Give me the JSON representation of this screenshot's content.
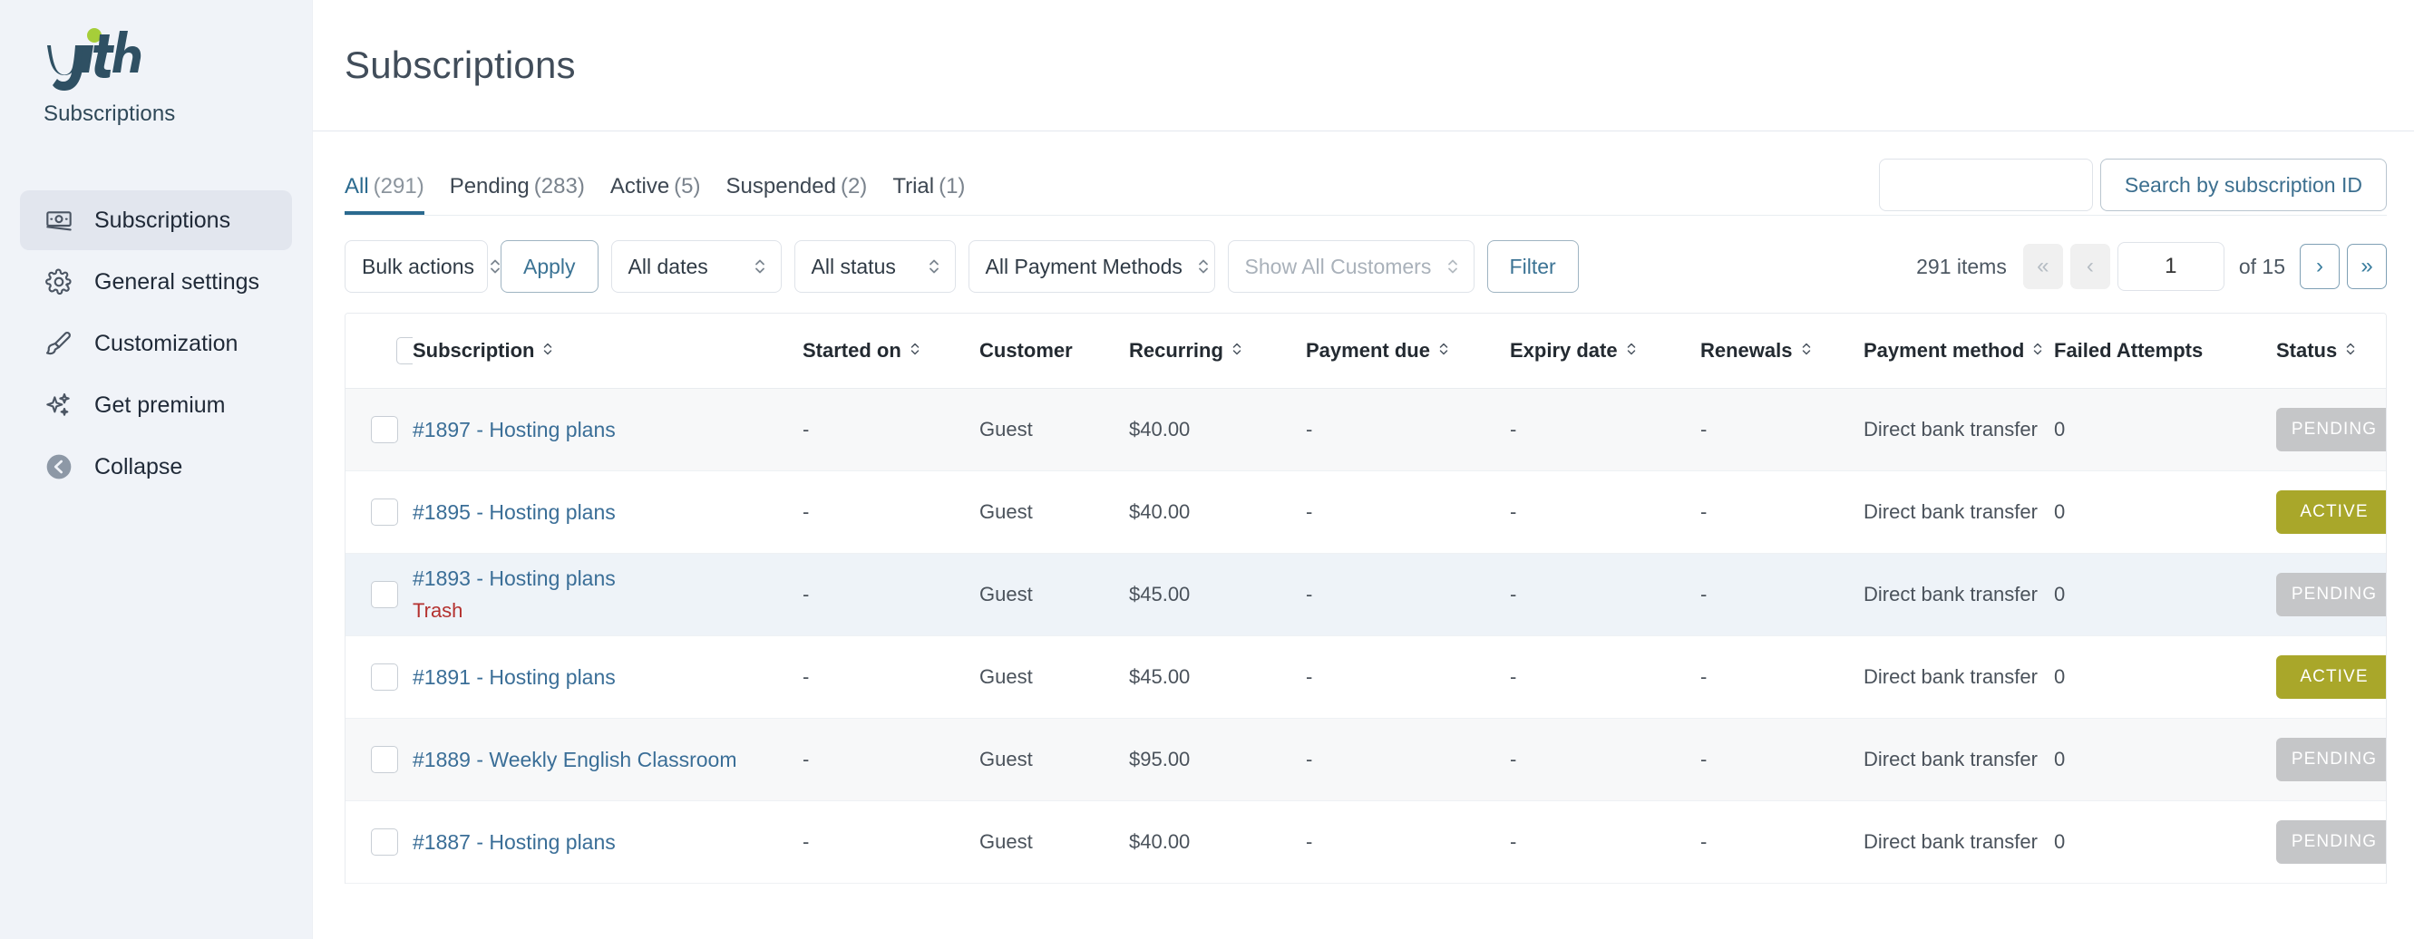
{
  "brand": {
    "name": "yith",
    "subtitle": "Subscriptions"
  },
  "sidebar": {
    "items": [
      {
        "label": "Subscriptions",
        "icon": "money-note-icon",
        "active": true
      },
      {
        "label": "General settings",
        "icon": "gear-icon",
        "active": false
      },
      {
        "label": "Customization",
        "icon": "brush-icon",
        "active": false
      },
      {
        "label": "Get premium",
        "icon": "sparkles-icon",
        "active": false
      },
      {
        "label": "Collapse",
        "icon": "arrow-left-circle-icon",
        "active": false
      }
    ]
  },
  "header": {
    "title": "Subscriptions"
  },
  "search": {
    "value": "",
    "placeholder": "",
    "button_label": "Search by subscription ID"
  },
  "tabs": [
    {
      "label": "All",
      "count": "(291)",
      "active": true
    },
    {
      "label": "Pending",
      "count": "(283)",
      "active": false
    },
    {
      "label": "Active",
      "count": "(5)",
      "active": false
    },
    {
      "label": "Suspended",
      "count": "(2)",
      "active": false
    },
    {
      "label": "Trial",
      "count": "(1)",
      "active": false
    }
  ],
  "toolbar": {
    "bulk_actions": "Bulk actions",
    "apply_label": "Apply",
    "dates": "All dates",
    "status": "All status",
    "payment_methods": "All Payment Methods",
    "customers_placeholder": "Show All Customers",
    "filter_label": "Filter"
  },
  "pagination": {
    "items_label": "291 items",
    "first": "«",
    "prev": "‹",
    "page": "1",
    "of_label": "of 15",
    "next": "›",
    "last": "»"
  },
  "table": {
    "columns": [
      {
        "label": "Subscription",
        "sortable": true
      },
      {
        "label": "Started on",
        "sortable": true
      },
      {
        "label": "Customer",
        "sortable": false
      },
      {
        "label": "Recurring",
        "sortable": true
      },
      {
        "label": "Payment due",
        "sortable": true
      },
      {
        "label": "Expiry date",
        "sortable": true
      },
      {
        "label": "Renewals",
        "sortable": true
      },
      {
        "label": "Payment method",
        "sortable": true
      },
      {
        "label": "Failed Attempts",
        "sortable": false
      },
      {
        "label": "Status",
        "sortable": true
      }
    ],
    "rows": [
      {
        "subscription": "#1897 - Hosting plans",
        "trash": "",
        "started_on": "-",
        "customer": "Guest",
        "recurring": "$40.00",
        "payment_due": "-",
        "expiry_date": "-",
        "renewals": "-",
        "payment_method": "Direct bank transfer",
        "failed_attempts": "0",
        "status": "PENDING",
        "status_kind": "pending",
        "shade": "alt"
      },
      {
        "subscription": "#1895 - Hosting plans",
        "trash": "",
        "started_on": "-",
        "customer": "Guest",
        "recurring": "$40.00",
        "payment_due": "-",
        "expiry_date": "-",
        "renewals": "-",
        "payment_method": "Direct bank transfer",
        "failed_attempts": "0",
        "status": "ACTIVE",
        "status_kind": "active",
        "shade": "plain"
      },
      {
        "subscription": "#1893 - Hosting plans",
        "trash": "Trash",
        "started_on": "-",
        "customer": "Guest",
        "recurring": "$45.00",
        "payment_due": "-",
        "expiry_date": "-",
        "renewals": "-",
        "payment_method": "Direct bank transfer",
        "failed_attempts": "0",
        "status": "PENDING",
        "status_kind": "pending",
        "shade": "hover"
      },
      {
        "subscription": "#1891 - Hosting plans",
        "trash": "",
        "started_on": "-",
        "customer": "Guest",
        "recurring": "$45.00",
        "payment_due": "-",
        "expiry_date": "-",
        "renewals": "-",
        "payment_method": "Direct bank transfer",
        "failed_attempts": "0",
        "status": "ACTIVE",
        "status_kind": "active",
        "shade": "plain"
      },
      {
        "subscription": "#1889 - Weekly English Classroom",
        "trash": "",
        "started_on": "-",
        "customer": "Guest",
        "recurring": "$95.00",
        "payment_due": "-",
        "expiry_date": "-",
        "renewals": "-",
        "payment_method": "Direct bank transfer",
        "failed_attempts": "0",
        "status": "PENDING",
        "status_kind": "pending",
        "shade": "alt"
      },
      {
        "subscription": "#1887 - Hosting plans",
        "trash": "",
        "started_on": "-",
        "customer": "Guest",
        "recurring": "$40.00",
        "payment_due": "-",
        "expiry_date": "-",
        "renewals": "-",
        "payment_method": "Direct bank transfer",
        "failed_attempts": "0",
        "status": "PENDING",
        "status_kind": "pending",
        "shade": "plain"
      }
    ]
  },
  "colors": {
    "brand_dark": "#2f5063",
    "brand_accent": "#a6ce39",
    "link": "#3a6e97",
    "trash": "#b4312f",
    "status_active": "#a9a72a",
    "status_pending": "#c5c6c8",
    "sidebar_bg": "#f0f3f8"
  }
}
